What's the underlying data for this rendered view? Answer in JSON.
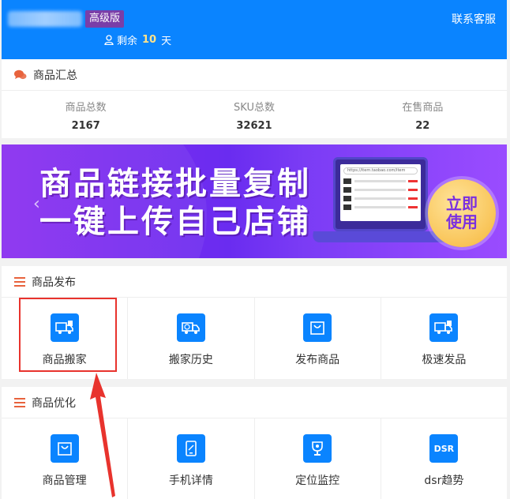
{
  "header": {
    "edition_badge": "高级版",
    "contact_link": "联系客服",
    "remain_prefix": "剩余",
    "remain_days": "10",
    "remain_suffix": "天"
  },
  "summary": {
    "title": "商品汇总",
    "stats": [
      {
        "label": "商品总数",
        "value": "2167"
      },
      {
        "label": "SKU总数",
        "value": "32621"
      },
      {
        "label": "在售商品",
        "value": "22"
      }
    ]
  },
  "banner": {
    "line1": "商品链接批量复制",
    "line2": "一键上传自己店铺",
    "url_text": "https://item.taobao.com/item",
    "cta_line1": "立即",
    "cta_line2": "使用"
  },
  "publish": {
    "title": "商品发布",
    "items": [
      {
        "label": "商品搬家",
        "icon": "truck-doc-icon"
      },
      {
        "label": "搬家历史",
        "icon": "truck-clock-icon"
      },
      {
        "label": "发布商品",
        "icon": "bag-icon"
      },
      {
        "label": "极速发品",
        "icon": "truck-doc-icon"
      }
    ]
  },
  "optimize": {
    "title": "商品优化",
    "items": [
      {
        "label": "商品管理",
        "icon": "bag-icon"
      },
      {
        "label": "手机详情",
        "icon": "tablet-icon"
      },
      {
        "label": "定位监控",
        "icon": "trophy-icon"
      },
      {
        "label": "dsr趋势",
        "icon": "dsr-icon",
        "icon_text": "DSR"
      }
    ]
  },
  "colors": {
    "header_bg": "#0a84ff",
    "badge_bg": "#7a3ea8",
    "accent_red": "#e8332d",
    "tile_icon_bg": "#0a84ff"
  }
}
